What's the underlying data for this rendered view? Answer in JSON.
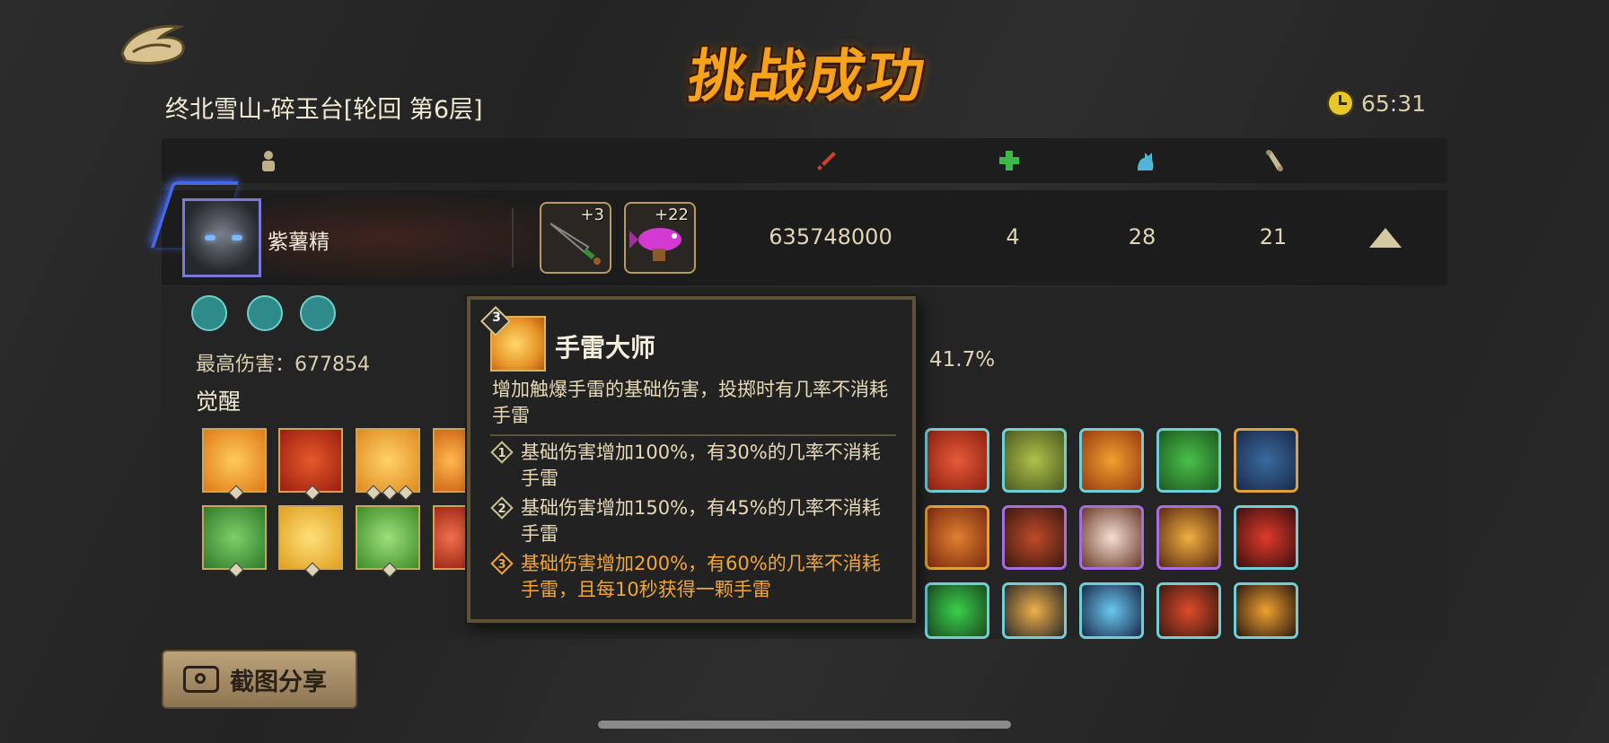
{
  "header": {
    "title": "挑战成功",
    "level_name": "终北雪山-碎玉台[轮回 第6层]",
    "timer": "65:31"
  },
  "columns": {
    "icons": [
      "player-icon",
      "damage-sword-icon",
      "heal-cross-icon",
      "pet-cat-icon",
      "scroll-icon"
    ]
  },
  "player": {
    "name": "紫薯精",
    "weapons": [
      {
        "icon": "dagger-icon",
        "level": "+3"
      },
      {
        "icon": "fish-gun-icon",
        "level": "+22"
      }
    ],
    "stats": {
      "damage": "635748000",
      "heal": "4",
      "pet": "28",
      "scroll": "21"
    }
  },
  "details": {
    "max_damage": "最高伤害：677854",
    "awaken_label": "觉醒",
    "percent": "41.7%"
  },
  "tooltip": {
    "badge": "3",
    "title": "手雷大师",
    "description": "增加触爆手雷的基础伤害，投掷时有几率不消耗手雷",
    "levels": [
      {
        "num": "1",
        "text": "基础伤害增加100%，有30%的几率不消耗手雷"
      },
      {
        "num": "2",
        "text": "基础伤害增加150%，有45%的几率不消耗手雷"
      },
      {
        "num": "3",
        "text": "基础伤害增加200%，有60%的几率不消耗手雷，且每10秒获得一颗手雷"
      }
    ]
  },
  "actions": {
    "share_label": "截图分享"
  },
  "colors": {
    "accent_orange": "#f3a632",
    "gold_border": "#c9a65a",
    "cyan_border": "#6ecfd8",
    "purple_border": "#a56ee0"
  }
}
